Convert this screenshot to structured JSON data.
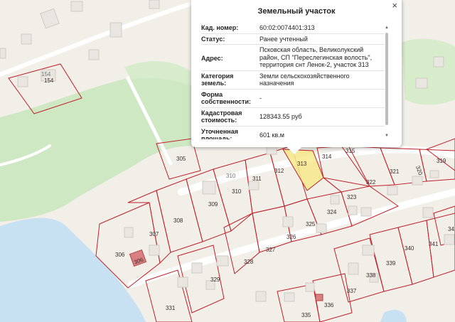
{
  "popup": {
    "title": "Земельный участок",
    "close_glyph": "×",
    "rows": [
      {
        "key": "Кад. номер:",
        "value": "60:02:0074401:313"
      },
      {
        "key": "Статус:",
        "value": "Ранее учтенный"
      },
      {
        "key": "Адрес:",
        "value": "Псковская область, Великолукский район, СП \"Переслегинская волость\", территория снт Ленок-2, участок 313"
      },
      {
        "key": "Категория земель:",
        "value": "Земли сельскохозяйственного назначения"
      },
      {
        "key": "Форма собственности:",
        "value": "-"
      },
      {
        "key": "Кадастровая стоимость:",
        "value": "128343.55 руб"
      },
      {
        "key": "Уточненная площадь:",
        "value": "601 кв.м"
      }
    ]
  },
  "map": {
    "parcel_labels": [
      "154",
      "305",
      "306",
      "307",
      "308",
      "309",
      "310",
      "311",
      "312",
      "313",
      "314",
      "315",
      "319",
      "320",
      "321",
      "322",
      "323",
      "324",
      "325",
      "326",
      "327",
      "328",
      "329",
      "331",
      "335",
      "336",
      "337",
      "338",
      "339",
      "340",
      "341",
      "342"
    ],
    "building_labels": [
      "154",
      "310",
      "306"
    ],
    "colors": {
      "parcel_border": "#c0202a",
      "selected_fill": "#f7e98c",
      "greenery": "#cfe8c4",
      "water": "#c7e0f2",
      "road": "#ffffff",
      "land": "#f2efe9"
    }
  }
}
